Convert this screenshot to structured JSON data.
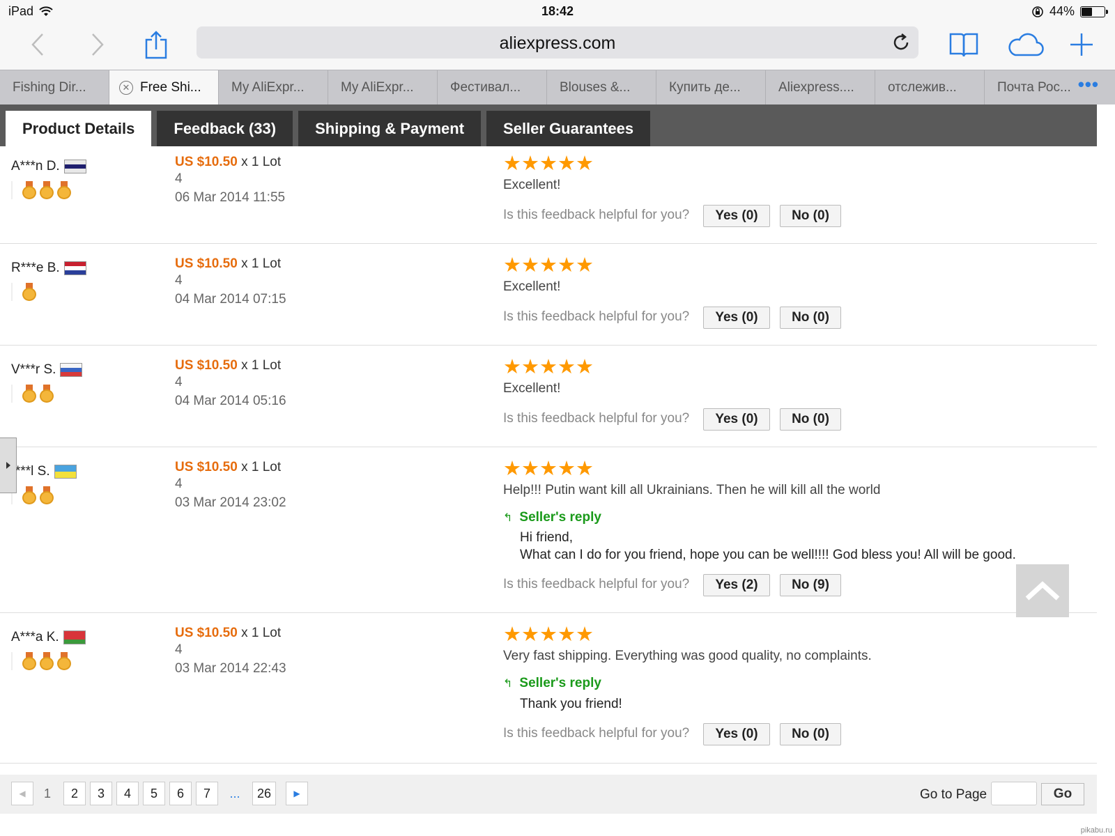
{
  "status": {
    "device": "iPad",
    "time": "18:42",
    "battery": "44%",
    "battery_level": 0.44
  },
  "browser": {
    "url": "aliexpress.com"
  },
  "tabs": [
    {
      "label": "Fishing Dir..."
    },
    {
      "label": "Free Shi..."
    },
    {
      "label": "My AliExpr..."
    },
    {
      "label": "My AliExpr..."
    },
    {
      "label": "Фестивал..."
    },
    {
      "label": "Blouses &..."
    },
    {
      "label": "Купить де..."
    },
    {
      "label": "Aliexpress...."
    },
    {
      "label": "отслежив..."
    },
    {
      "label": "Почта Рос..."
    }
  ],
  "more_tabs": "•••",
  "product_tabs": [
    {
      "label": "Product Details"
    },
    {
      "label": "Feedback (33)"
    },
    {
      "label": "Shipping & Payment"
    },
    {
      "label": "Seller Guarantees"
    }
  ],
  "feedback": [
    {
      "buyer": "A***n D.",
      "price": "US $10.50",
      "unit": "x 1 Lot",
      "qty": "4",
      "date": "06 Mar 2014 11:55",
      "comment": "Excellent!",
      "helpful": "Is this feedback helpful for you?",
      "yes": "Yes (0)",
      "no": "No (0)"
    },
    {
      "buyer": "R***e B.",
      "price": "US $10.50",
      "unit": "x 1 Lot",
      "qty": "4",
      "date": "04 Mar 2014 07:15",
      "comment": "Excellent!",
      "helpful": "Is this feedback helpful for you?",
      "yes": "Yes (0)",
      "no": "No (0)"
    },
    {
      "buyer": "V***r S.",
      "price": "US $10.50",
      "unit": "x 1 Lot",
      "qty": "4",
      "date": "04 Mar 2014 05:16",
      "comment": "Excellent!",
      "helpful": "Is this feedback helpful for you?",
      "yes": "Yes (0)",
      "no": "No (0)"
    },
    {
      "buyer": "***l S.",
      "price": "US $10.50",
      "unit": "x 1 Lot",
      "qty": "4",
      "date": "03 Mar 2014 23:02",
      "comment": "Help!!! Putin want kill all Ukrainians. Then he will kill all the world",
      "reply_title": "Seller's reply",
      "reply_line1": "Hi friend,",
      "reply_line2": "What can I do for you friend, hope you can be well!!!! God bless you! All will be good.",
      "helpful": "Is this feedback helpful for you?",
      "yes": "Yes (2)",
      "no": "No (9)"
    },
    {
      "buyer": "A***a K.",
      "price": "US $10.50",
      "unit": "x 1 Lot",
      "qty": "4",
      "date": "03 Mar 2014 22:43",
      "comment": "Very fast shipping. Everything was good quality, no complaints.",
      "reply_title": "Seller's reply",
      "reply_line1": "Thank you friend!",
      "helpful": "Is this feedback helpful for you?",
      "yes": "Yes (0)",
      "no": "No (0)"
    }
  ],
  "pagination": {
    "pages": [
      "1",
      "2",
      "3",
      "4",
      "5",
      "6",
      "7",
      "...",
      "26"
    ],
    "current": "1",
    "goto_label": "Go to Page",
    "go": "Go"
  },
  "watermark": "pikabu.ru",
  "colors": {
    "accent": "#2a7de1",
    "price": "#e66c0d",
    "reply": "#1a9a1a",
    "stars": "#ff9900"
  }
}
